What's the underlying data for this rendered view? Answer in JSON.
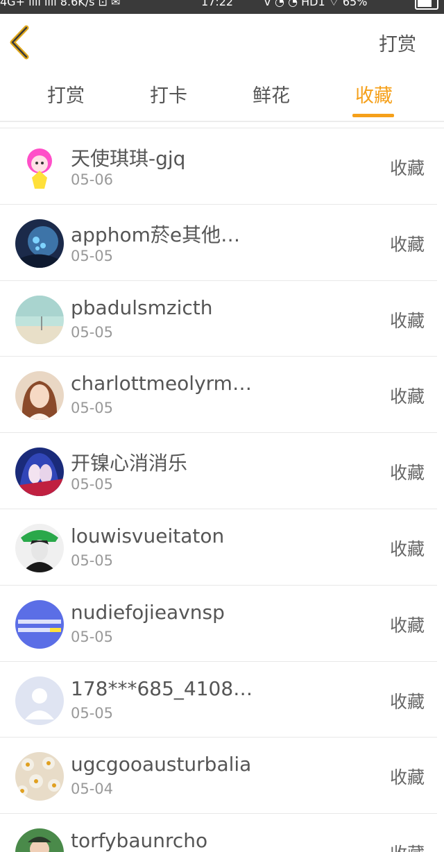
{
  "status_bar": {
    "left": "4G+ ııll ııll 8.6K/s ⊡ ✉",
    "time": "17:22",
    "right": "ᐁ ◔ ◔ HD1 ⌔ 65%"
  },
  "header": {
    "right_label": "打赏"
  },
  "tabs": [
    {
      "label": "打赏"
    },
    {
      "label": "打卡"
    },
    {
      "label": "鲜花"
    },
    {
      "label": "收藏"
    }
  ],
  "active_tab": "收藏",
  "list": [
    {
      "name": "天使琪琪-gjq",
      "date": "05-06",
      "action": "收藏"
    },
    {
      "name": "apphom菸e其他…",
      "date": "05-05",
      "action": "收藏"
    },
    {
      "name": "pbadulsmzicth",
      "date": "05-05",
      "action": "收藏"
    },
    {
      "name": "charlottmeolyrm…",
      "date": "05-05",
      "action": "收藏"
    },
    {
      "name": "开镍心消消乐",
      "date": "05-05",
      "action": "收藏"
    },
    {
      "name": "louwisvueitaton",
      "date": "05-05",
      "action": "收藏"
    },
    {
      "name": "nudiefojieavnsp",
      "date": "05-05",
      "action": "收藏"
    },
    {
      "name": "178***685_4108…",
      "date": "05-05",
      "action": "收藏"
    },
    {
      "name": "ugcgooausturbalia",
      "date": "05-04",
      "action": "收藏"
    },
    {
      "name": "torfybaunrcho",
      "date": "",
      "action": "收藏"
    }
  ],
  "colors": {
    "accent": "#f5a01a",
    "text": "#555555",
    "muted": "#999999",
    "divider": "#e8e8e8"
  },
  "icons": {
    "back": "chevron-left-icon"
  }
}
